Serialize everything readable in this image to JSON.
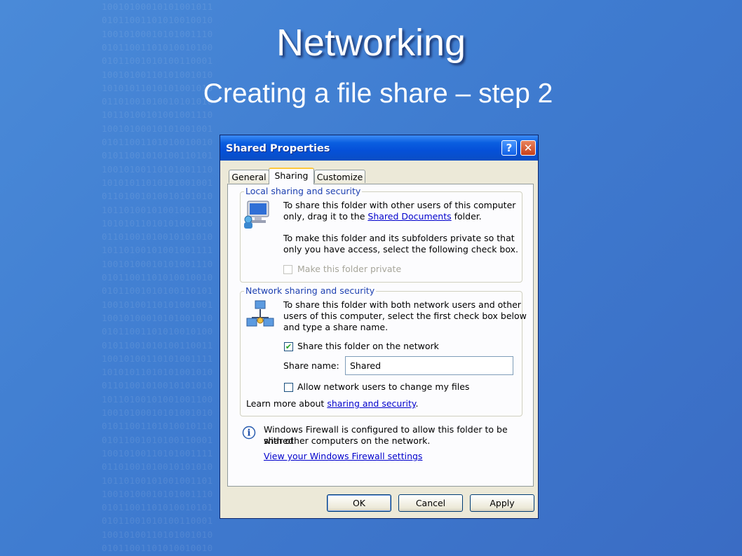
{
  "slide": {
    "title": "Networking",
    "subtitle": "Creating a file share – step 2",
    "background_binary": [
      "10010100010101001011",
      "01011001101010010010",
      "10010100010101001110",
      "01011001101010010100",
      "01011001010100110001",
      "10010100110101001010",
      "10101011010101001010",
      "01101001010010101010",
      "10110100101001001110",
      "10010100010101001001",
      "01011001101010010010",
      "01011001010100110101",
      "10010100110101001110",
      "10101011010101001001",
      "01101001010010101010",
      "10110100101001001101",
      "10101011010101001010",
      "01101001010010101010",
      "10110100101001001111",
      "10010100010101001110",
      "01011001101010010010",
      "01011001010100110101",
      "10010100110101001001",
      "10010100010101001010",
      "01011001101010010100",
      "01011001010100110011",
      "10010100110101001111",
      "10101011010101001010",
      "01101001010010101010",
      "10110100101001001100",
      "10010100010101001010",
      "01011001101010010110",
      "01011001010100110001",
      "10010100110101001111",
      "01101001010010101010",
      "10110100101001001101",
      "10010100010101001110",
      "01011001101010010101",
      "01011001010100110001",
      "10010100110101001010",
      "01011001101010010010"
    ]
  },
  "dialog": {
    "title": "Shared Properties",
    "help_glyph": "?",
    "close_glyph": "✕",
    "tabs": [
      {
        "label": "General"
      },
      {
        "label": "Sharing"
      },
      {
        "label": "Customize"
      }
    ],
    "local": {
      "legend": "Local sharing and security",
      "text1_a": "To share this folder with other users of this computer",
      "text1_b": "only, drag it to the ",
      "text1_link": "Shared Documents",
      "text1_c": " folder.",
      "text2_a": "To make this folder and its subfolders private so that",
      "text2_b": "only you have access, select the following check box.",
      "private_checkbox_label": "Make this folder private",
      "private_checked": false
    },
    "network": {
      "legend": "Network sharing and security",
      "text_a": "To share this folder with both network users and other",
      "text_b": "users of this computer, select the first check box below",
      "text_c": "and type a share name.",
      "share_checkbox_label": "Share this folder on the network",
      "share_checked": true,
      "share_mark": "✔",
      "share_name_label": "Share name:",
      "share_name_value": "Shared",
      "allow_checkbox_label": "Allow network users to change my files",
      "allow_checked": false,
      "learn_more_prefix": "Learn more about ",
      "learn_more_link": "sharing and security",
      "learn_more_suffix": "."
    },
    "firewall": {
      "info_glyph": "i",
      "text_a": "Windows Firewall is configured to allow this folder to be shared",
      "text_b": "with other computers on the network.",
      "link": "View your Windows Firewall settings"
    },
    "buttons": {
      "ok": "OK",
      "cancel": "Cancel",
      "apply": "Apply"
    }
  }
}
